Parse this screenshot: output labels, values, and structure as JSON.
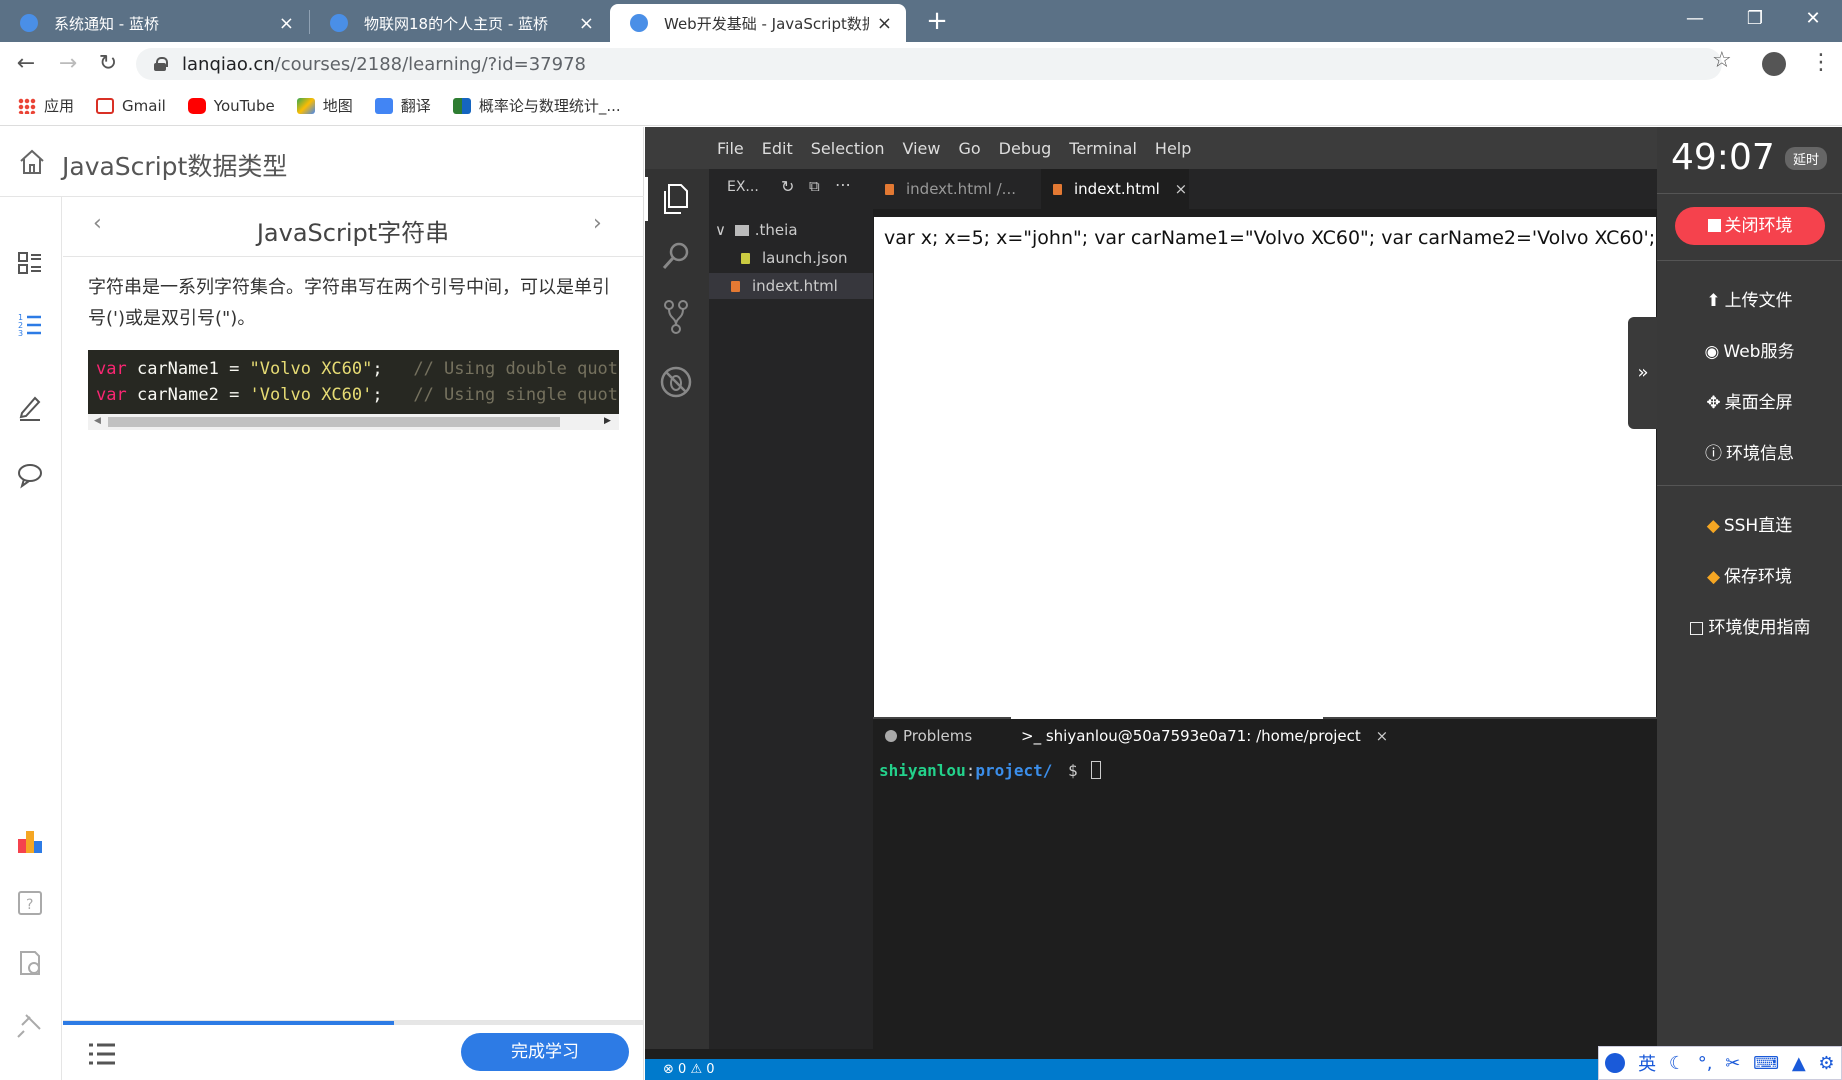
{
  "browser": {
    "tabs": [
      {
        "label": "系统通知 - 蓝桥",
        "close": "×"
      },
      {
        "label": "物联网18的个人主页 - 蓝桥",
        "close": "×"
      },
      {
        "label": "Web开发基础 - JavaScript数据类型",
        "close": "×"
      }
    ],
    "new_tab": "+",
    "window_controls": {
      "minimize": "—",
      "maximize": "❐",
      "close": "✕"
    },
    "url_host": "lanqiao.cn",
    "url_path": "/courses/2188/learning/?id=37978",
    "bookmarks": [
      "应用",
      "Gmail",
      "YouTube",
      "地图",
      "翻译",
      "概率论与数理统计_..."
    ]
  },
  "course": {
    "title": "JavaScript数据类型",
    "lesson_title": "JavaScript字符串",
    "paragraph": "字符串是一系列字符集合。字符串写在两个引号中间，可以是单引号(')或是双引号(\")。",
    "code_lines": [
      {
        "kw": "var",
        "ident": " carName1 = ",
        "str": "\"Volvo XC60\"",
        "semi": ";",
        "comment": "   // Using double quotes"
      },
      {
        "kw": "var",
        "ident": " carName2 = ",
        "str": "'Volvo XC60'",
        "semi": ";",
        "comment": "   // Using single quotes"
      }
    ],
    "progress_fraction": 0.57,
    "complete_button": "完成学习"
  },
  "ide": {
    "menu": [
      "File",
      "Edit",
      "Selection",
      "View",
      "Go",
      "Debug",
      "Terminal",
      "Help"
    ],
    "explorer_title": "EX...",
    "tree": [
      ".theia",
      "launch.json",
      "indext.html"
    ],
    "editor_tabs": [
      "indext.html /...",
      "indext.html"
    ],
    "preview_text": "var x; x=5; x=\"john\"; var carName1=\"Volvo XC60\"; var carName2='Volvo XC60';",
    "panel_tabs": [
      "Problems",
      "shiyanlou@50a7593e0a71: /home/project"
    ],
    "terminal": {
      "user": "shiyanlou",
      "path": "project/",
      "prompt": "$"
    },
    "status": {
      "errors": "0",
      "warnings": "0"
    }
  },
  "tools": {
    "timer": "49:07",
    "timer_badge": "延时",
    "close_env": "关闭环境",
    "items": [
      "上传文件",
      "Web服务",
      "桌面全屏",
      "环境信息"
    ],
    "items2": [
      "SSH直连",
      "保存环境",
      "环境使用指南"
    ]
  },
  "ime": {
    "mode": "英"
  }
}
